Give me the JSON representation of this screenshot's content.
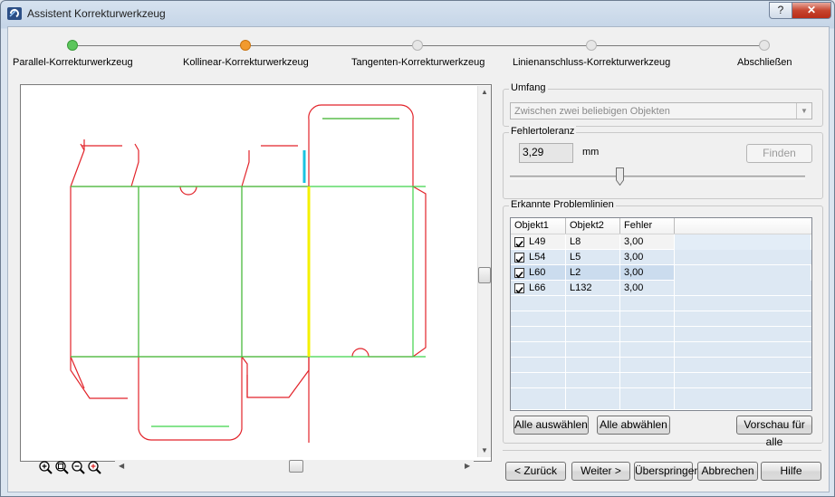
{
  "window": {
    "title": "Assistent Korrekturwerkzeug",
    "help_label": "?",
    "close_label": "✕"
  },
  "steps": [
    {
      "label": "Parallel-Korrekturwerkzeug",
      "color": "#5cc65c"
    },
    {
      "label": "Kollinear-Korrekturwerkzeug",
      "color": "#f29a2e"
    },
    {
      "label": "Tangenten-Korrekturwerkzeug",
      "color": "#d8d8d8"
    },
    {
      "label": "Linienanschluss-Korrekturwerkzeug",
      "color": "#d8d8d8"
    },
    {
      "label": "Abschließen",
      "color": "#d8d8d8"
    }
  ],
  "umfang": {
    "label": "Umfang",
    "value": "Zwischen zwei beliebigen Objekten"
  },
  "fehlertoleranz": {
    "label": "Fehlertoleranz",
    "value": "3,29",
    "unit": "mm",
    "find_label": "Finden",
    "slider_fraction": 0.37
  },
  "problemlinien": {
    "label": "Erkannte Problemlinien",
    "columns": [
      "Objekt1",
      "Objekt2",
      "Fehler"
    ],
    "rows": [
      {
        "obj1": "L49",
        "obj2": "L8",
        "error": "3,00",
        "checked": true
      },
      {
        "obj1": "L54",
        "obj2": "L5",
        "error": "3,00",
        "checked": true
      },
      {
        "obj1": "L60",
        "obj2": "L2",
        "error": "3,00",
        "checked": true
      },
      {
        "obj1": "L66",
        "obj2": "L132",
        "error": "3,00",
        "checked": true
      }
    ],
    "select_all_label": "Alle auswählen",
    "deselect_all_label": "Alle abwählen",
    "preview_all_label": "Vorschau für alle"
  },
  "footer": {
    "back_label": "< Zurück",
    "next_label": "Weiter >",
    "skip_label": "Überspringen",
    "cancel_label": "Abbrechen",
    "help_label": "Hilfe"
  },
  "zoom_tools": [
    "zoom-in-icon",
    "zoom-area-icon",
    "zoom-out-icon",
    "zoom-fit-icon"
  ]
}
